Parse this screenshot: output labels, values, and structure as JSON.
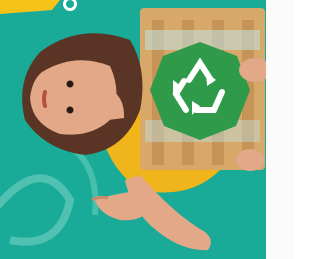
{
  "scene": {
    "colors": {
      "background": "#1aab98",
      "recycle_badge": "#2f9a4a",
      "crate": "#d8a868",
      "shirt": "#f0b51a",
      "hair": "#5a3424",
      "skin": "#e2a887",
      "banner_yellow": "#f6c419"
    },
    "icons": [
      "recycle-icon"
    ]
  }
}
